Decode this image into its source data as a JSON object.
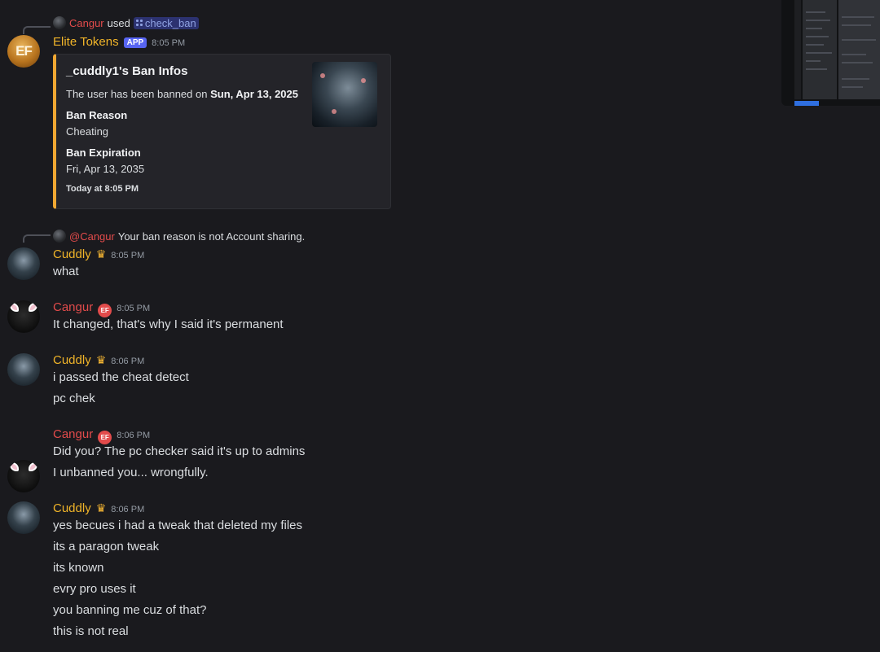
{
  "interaction": {
    "user": "Cangur",
    "used_text": "used",
    "command": "check_ban"
  },
  "bot_message": {
    "name": "Elite Tokens",
    "app_badge": "APP",
    "time": "8:05 PM",
    "avatar_text": "EF",
    "embed": {
      "title": "_cuddly1's Ban Infos",
      "desc_prefix": "The user has been banned on ",
      "desc_date": "Sun, Apr 13, 2025",
      "fields": [
        {
          "name": "Ban Reason",
          "value": "Cheating"
        },
        {
          "name": "Ban Expiration",
          "value": "Fri, Apr 13, 2035"
        }
      ],
      "footer": "Today at 8:05 PM",
      "accent_color": "#f0a732"
    }
  },
  "reply": {
    "mention": "@Cangur",
    "text": "Your ban reason is not Account sharing."
  },
  "messages": [
    {
      "name": "Cuddly",
      "time": "8:05 PM",
      "lines": [
        "what"
      ]
    },
    {
      "name": "Cangur",
      "time": "8:05 PM",
      "badge": "EF",
      "lines": [
        "It changed, that's why I said it's permanent"
      ]
    },
    {
      "name": "Cuddly",
      "time": "8:06 PM",
      "lines": [
        "i passed the cheat detect",
        "pc chek"
      ]
    },
    {
      "name": "Cangur",
      "time": "8:06 PM",
      "badge": "EF",
      "lines": [
        "Did you? The pc checker said it's up to admins",
        "I unbanned you... wrongfully."
      ]
    },
    {
      "name": "Cuddly",
      "time": "8:06 PM",
      "lines": [
        "yes becues i had a tweak that deleted my files",
        "its a paragon tweak",
        "its known",
        "evry pro uses it",
        "you banning me cuz of that?",
        "this is not real"
      ]
    }
  ],
  "colors": {
    "background": "#1a1a1e",
    "cuddly_name": "#f0b429",
    "cangur_name": "#e24b4b",
    "bot_name": "#f0b429",
    "app_badge": "#5865f2",
    "command_chip": "#2c3270"
  },
  "icons": {
    "command": "slash-command-icon",
    "crown": "crown-icon",
    "ef_badge": "ef-badge-icon"
  }
}
